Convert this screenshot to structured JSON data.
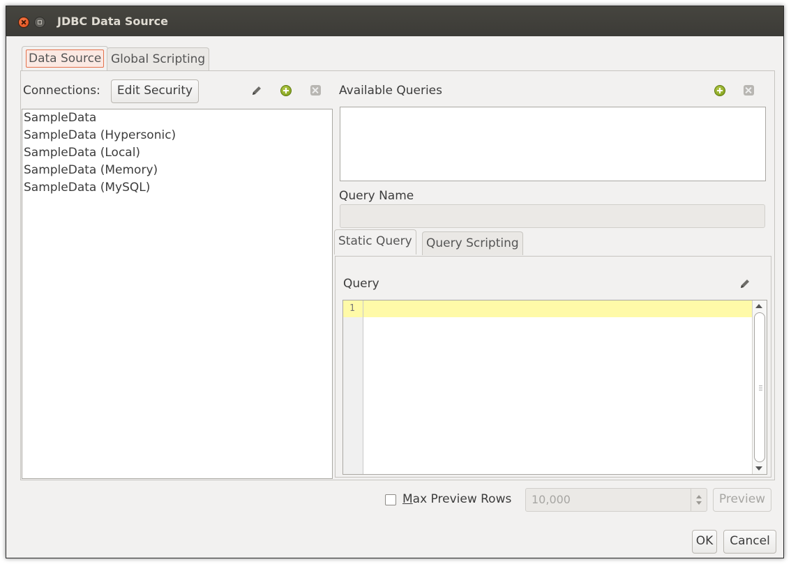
{
  "window": {
    "title": "JDBC Data Source"
  },
  "tabs": {
    "data_source": "Data Source",
    "global_scripting": "Global Scripting"
  },
  "connections": {
    "label": "Connections:",
    "edit_security_label": "Edit Security",
    "items": [
      "SampleData",
      "SampleData (Hypersonic)",
      "SampleData (Local)",
      "SampleData (Memory)",
      "SampleData (MySQL)"
    ]
  },
  "queries": {
    "available_label": "Available Queries",
    "query_name_label": "Query Name",
    "query_name_value": "",
    "tabs": {
      "static_query": "Static Query",
      "query_scripting": "Query Scripting"
    },
    "query_label": "Query",
    "line_number": "1",
    "query_text": ""
  },
  "preview": {
    "max_rows_label": "Max Preview Rows",
    "max_rows_mnemonic": "M",
    "max_rows_rest": "ax Preview Rows",
    "max_rows_value": "10,000",
    "max_rows_checked": false,
    "preview_label": "Preview"
  },
  "footer": {
    "ok_label": "OK",
    "cancel_label": "Cancel"
  },
  "colors": {
    "titlebar": "#3c3b37",
    "window_bg": "#f2f1f0",
    "focus_accent": "#e5714b",
    "current_line": "#fffaa8"
  }
}
